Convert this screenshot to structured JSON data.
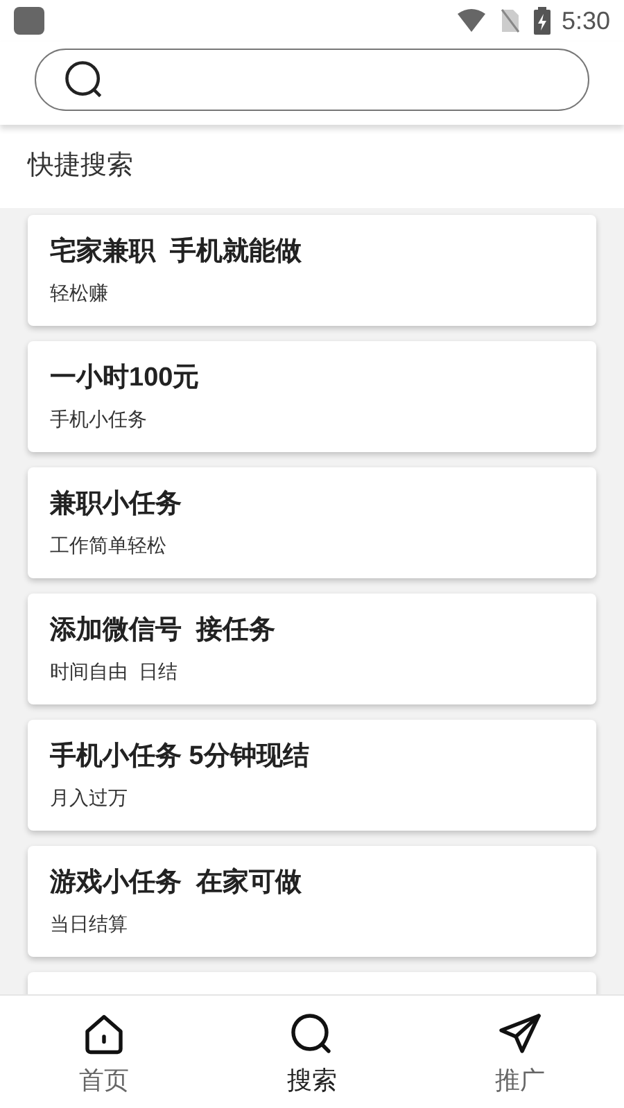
{
  "status_bar": {
    "time": "5:30"
  },
  "section_title": "快捷搜索",
  "items": [
    {
      "title": "宅家兼职  手机就能做",
      "subtitle": "轻松赚"
    },
    {
      "title": "一小时100元",
      "subtitle": "手机小任务"
    },
    {
      "title": "兼职小任务",
      "subtitle": "工作简单轻松"
    },
    {
      "title": "添加微信号  接任务",
      "subtitle": "时间自由  日结"
    },
    {
      "title": "手机小任务 5分钟现结",
      "subtitle": "月入过万"
    },
    {
      "title": "游戏小任务  在家可做",
      "subtitle": "当日结算"
    }
  ],
  "nav": [
    {
      "label": "首页",
      "kind": "home",
      "selected": false
    },
    {
      "label": "搜索",
      "kind": "search",
      "selected": true
    },
    {
      "label": "推广",
      "kind": "send",
      "selected": false
    }
  ]
}
